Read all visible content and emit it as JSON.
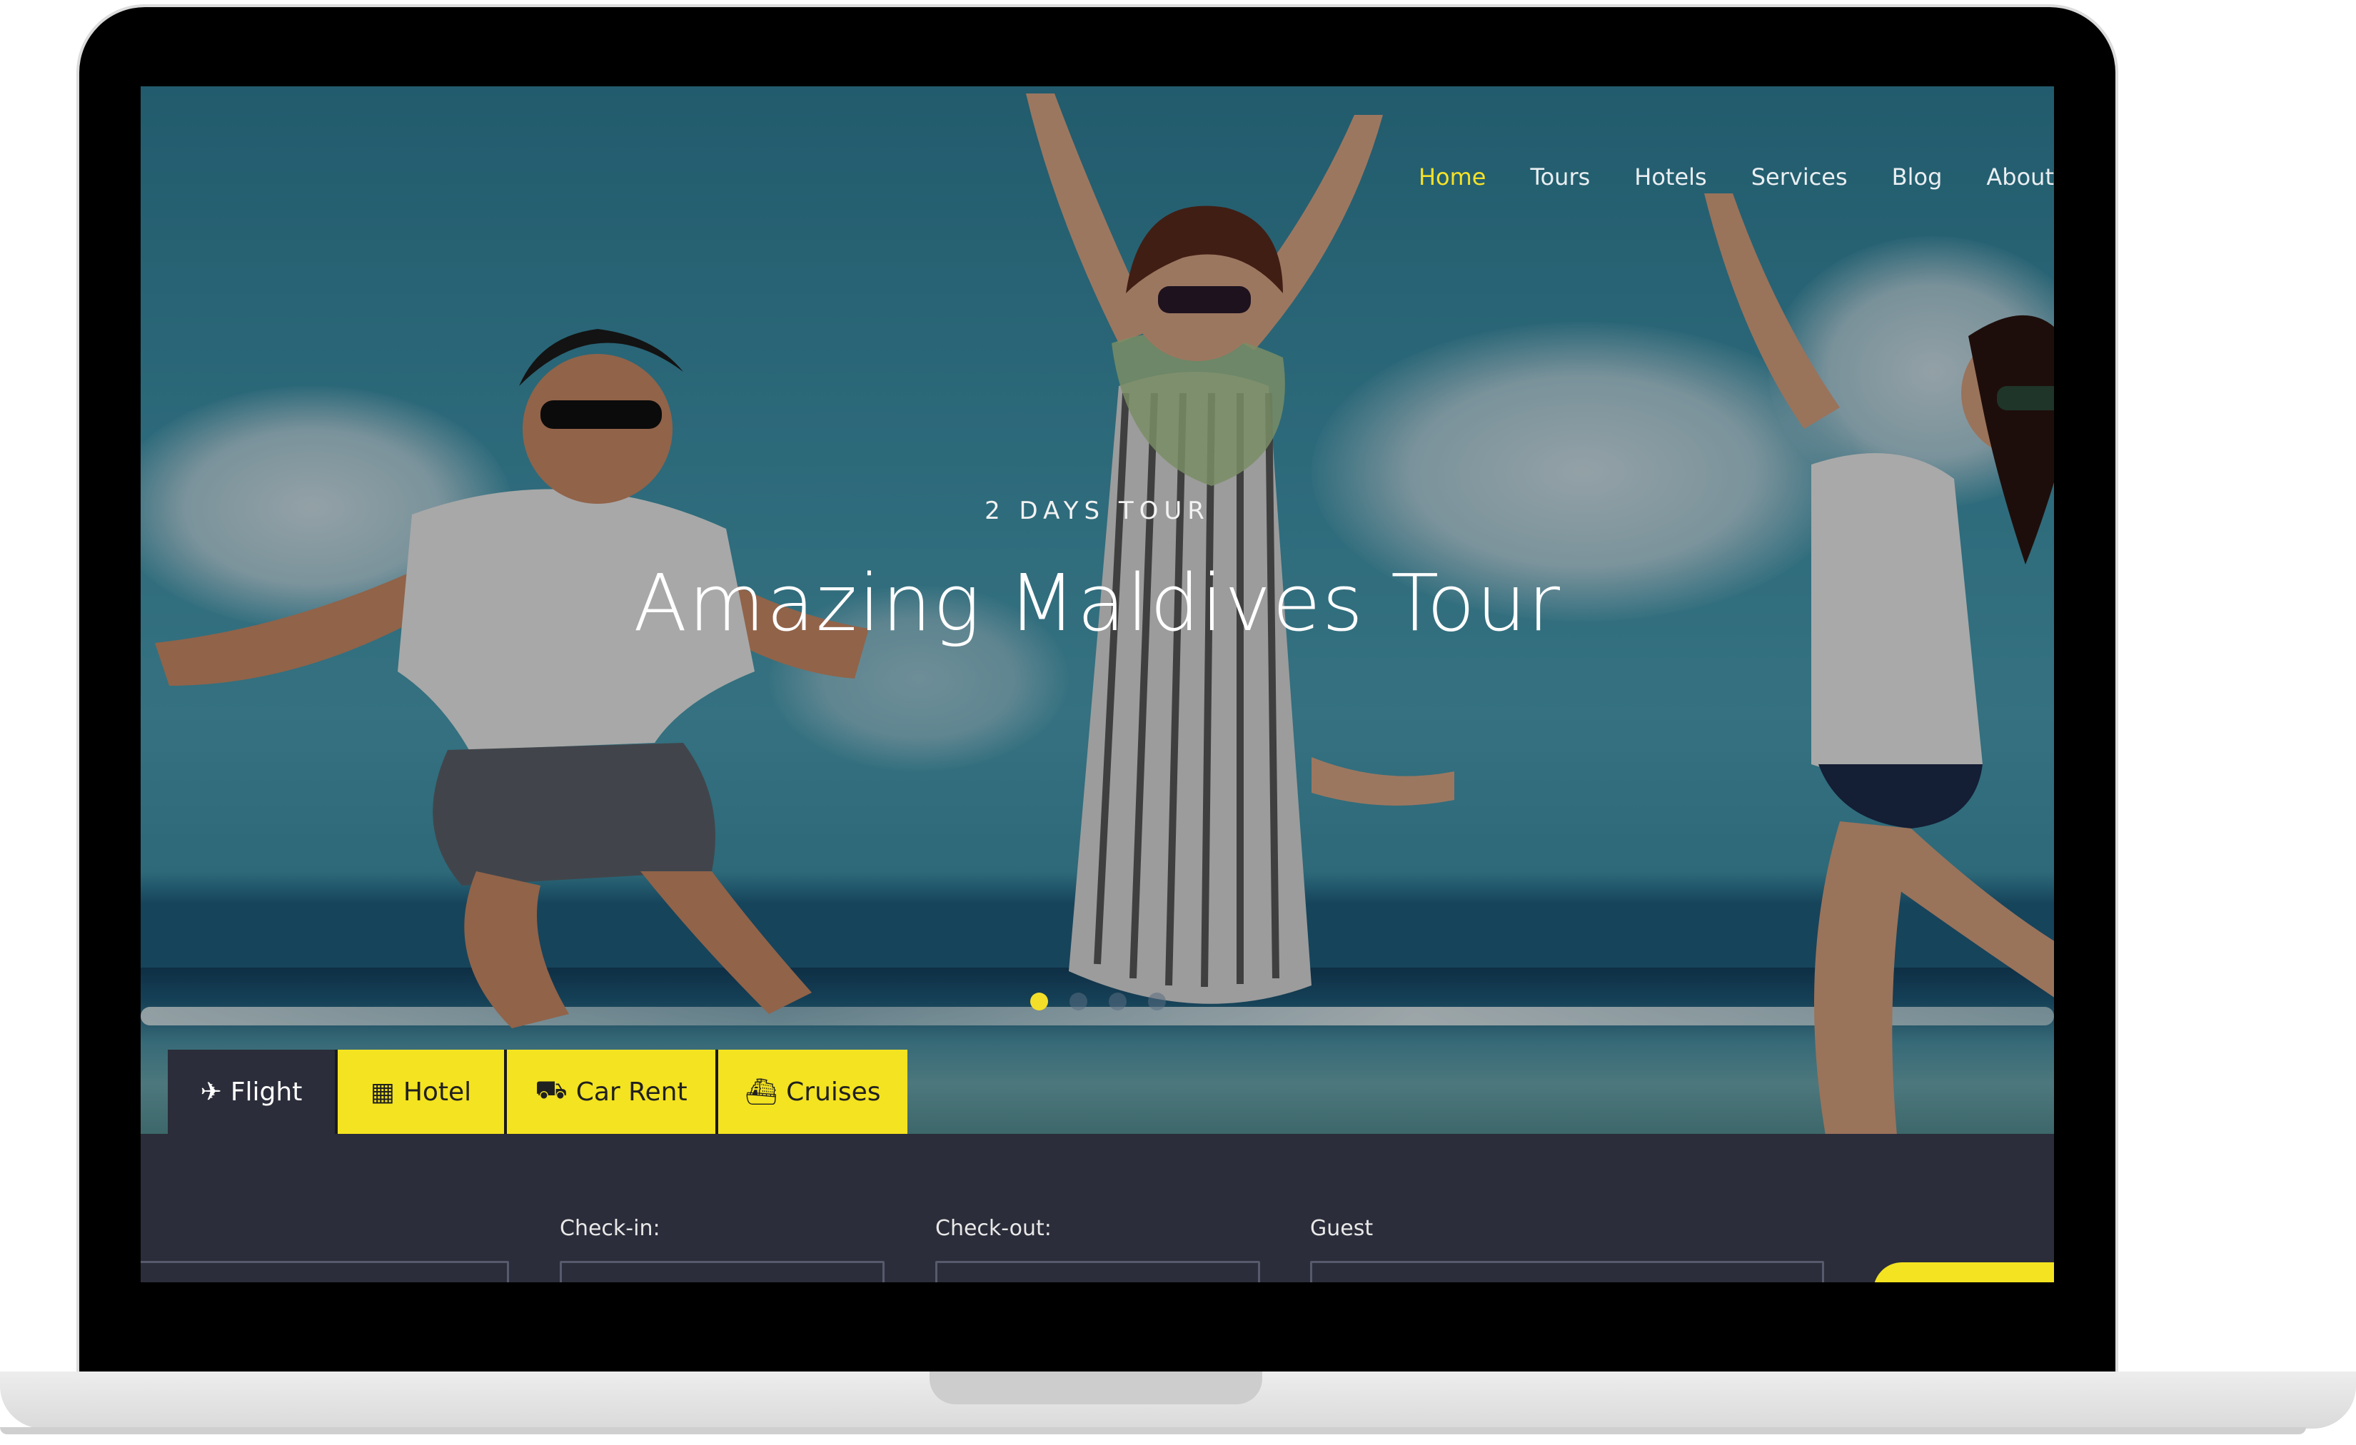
{
  "nav": {
    "items": [
      {
        "label": "Home",
        "active": true
      },
      {
        "label": "Tours",
        "active": false
      },
      {
        "label": "Hotels",
        "active": false
      },
      {
        "label": "Services",
        "active": false
      },
      {
        "label": "Blog",
        "active": false
      },
      {
        "label": "About",
        "active": false
      }
    ]
  },
  "hero": {
    "eyebrow": "2 DAYS TOUR",
    "title": "Amazing Maldives Tour",
    "slides_count": 4,
    "active_slide": 1
  },
  "booking": {
    "tabs": [
      {
        "label": "Flight",
        "icon": "plane-icon",
        "active": true
      },
      {
        "label": "Hotel",
        "icon": "building-icon",
        "active": false
      },
      {
        "label": "Car Rent",
        "icon": "taxi-icon",
        "active": false
      },
      {
        "label": "Cruises",
        "icon": "ship-icon",
        "active": false
      }
    ],
    "fields": [
      {
        "label": "Check-in:"
      },
      {
        "label": "Check-out:"
      },
      {
        "label": "Guest"
      }
    ]
  },
  "colors": {
    "accent": "#f4e320",
    "panel": "#2b2d3a",
    "nav_text": "#e9eef1"
  }
}
